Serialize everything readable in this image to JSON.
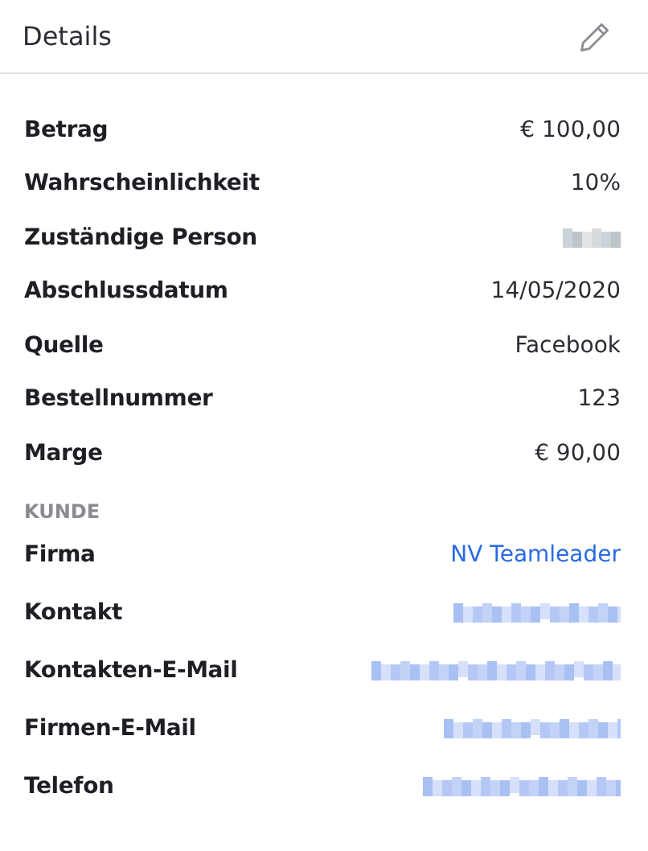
{
  "header": {
    "title": "Details"
  },
  "sections": [
    {
      "rows": [
        {
          "label": "Betrag",
          "kind": "text",
          "value": "€ 100,00"
        },
        {
          "label": "Wahrscheinlichkeit",
          "kind": "text",
          "value": "10%"
        },
        {
          "label": "Zuständige Person",
          "kind": "redacted"
        },
        {
          "label": "Abschlussdatum",
          "kind": "text",
          "value": "14/05/2020"
        },
        {
          "label": "Quelle",
          "kind": "text",
          "value": "Facebook"
        },
        {
          "label": "Bestellnummer",
          "kind": "text",
          "value": "123"
        },
        {
          "label": "Marge",
          "kind": "text",
          "value": "€ 90,00"
        }
      ]
    },
    {
      "title": "KUNDE",
      "rows": [
        {
          "label": "Firma",
          "kind": "link",
          "value": "NV Teamleader"
        },
        {
          "label": "Kontakt",
          "kind": "redacted-link"
        },
        {
          "label": "Kontakten-E-Mail",
          "kind": "redacted-link"
        },
        {
          "label": "Firmen-E-Mail",
          "kind": "redacted-link"
        },
        {
          "label": "Telefon",
          "kind": "redacted-link"
        }
      ]
    }
  ]
}
